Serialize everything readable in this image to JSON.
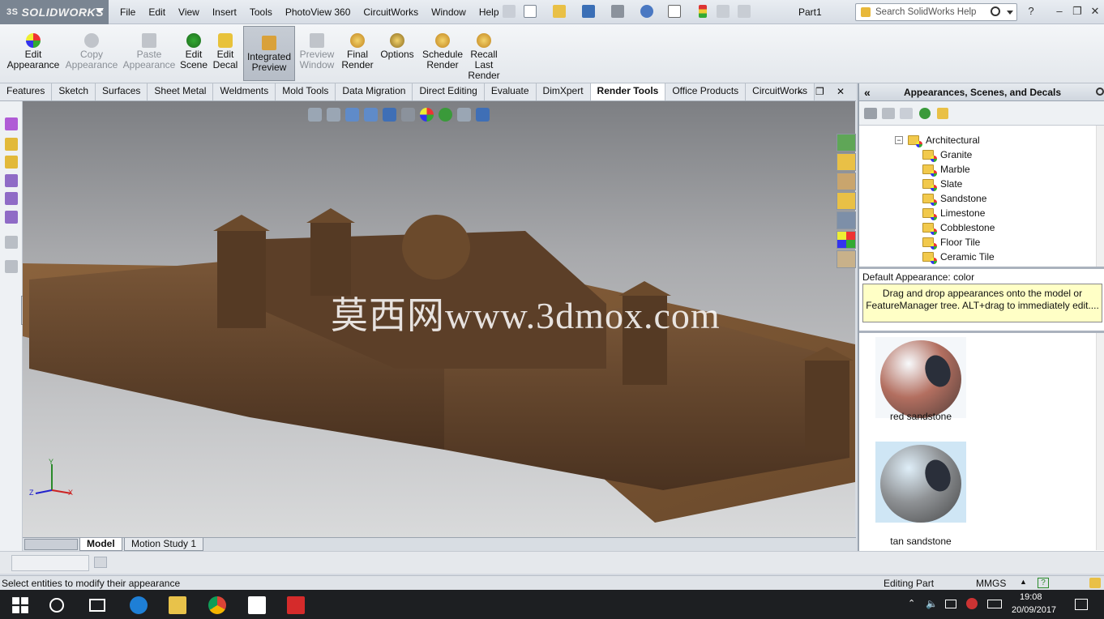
{
  "app": {
    "brand": "SOLIDWORKS",
    "brand_prefix": "3S",
    "document_title": "Part1"
  },
  "menu": [
    "File",
    "Edit",
    "View",
    "Insert",
    "Tools",
    "PhotoView 360",
    "CircuitWorks",
    "Window",
    "Help"
  ],
  "search": {
    "placeholder": "Search SolidWorks Help"
  },
  "ribbon": {
    "buttons": [
      {
        "label": "Edit\nAppearance",
        "enabled": true,
        "active": false,
        "icon": "edit-appearance-icon"
      },
      {
        "label": "Copy\nAppearance",
        "enabled": false,
        "active": false,
        "icon": "copy-appearance-icon"
      },
      {
        "label": "Paste\nAppearance",
        "enabled": false,
        "active": false,
        "icon": "paste-appearance-icon"
      },
      {
        "label": "Edit\nScene",
        "enabled": true,
        "active": false,
        "icon": "edit-scene-icon"
      },
      {
        "label": "Edit\nDecal",
        "enabled": true,
        "active": false,
        "icon": "edit-decal-icon"
      },
      {
        "label": "Integrated\nPreview",
        "enabled": true,
        "active": true,
        "icon": "integrated-preview-icon"
      },
      {
        "label": "Preview\nWindow",
        "enabled": false,
        "active": false,
        "icon": "preview-window-icon"
      },
      {
        "label": "Final\nRender",
        "enabled": true,
        "active": false,
        "icon": "final-render-icon"
      },
      {
        "label": "Options",
        "enabled": true,
        "active": false,
        "icon": "options-icon"
      },
      {
        "label": "Schedule\nRender",
        "enabled": true,
        "active": false,
        "icon": "schedule-render-icon"
      },
      {
        "label": "Recall\nLast\nRender",
        "enabled": true,
        "active": false,
        "icon": "recall-last-render-icon"
      }
    ]
  },
  "tabs": [
    {
      "label": "Features",
      "active": false
    },
    {
      "label": "Sketch",
      "active": false
    },
    {
      "label": "Surfaces",
      "active": false
    },
    {
      "label": "Sheet Metal",
      "active": false
    },
    {
      "label": "Weldments",
      "active": false
    },
    {
      "label": "Mold Tools",
      "active": false
    },
    {
      "label": "Data Migration",
      "active": false
    },
    {
      "label": "Direct Editing",
      "active": false
    },
    {
      "label": "Evaluate",
      "active": false
    },
    {
      "label": "DimXpert",
      "active": false
    },
    {
      "label": "Render Tools",
      "active": true
    },
    {
      "label": "Office Products",
      "active": false
    },
    {
      "label": "CircuitWorks",
      "active": false
    }
  ],
  "viewport": {
    "watermark": "莫西网www.3dmox.com",
    "triad": {
      "x": "X",
      "y": "Y",
      "z": "Z"
    }
  },
  "bottom_tabs": [
    {
      "label": "Model",
      "active": true
    },
    {
      "label": "Motion Study 1",
      "active": false
    }
  ],
  "task_pane": {
    "title": "Appearances, Scenes, and Decals",
    "collapse_glyph": "«",
    "tree": {
      "parent": "Architectural",
      "children": [
        "Granite",
        "Marble",
        "Slate",
        "Sandstone",
        "Limestone",
        "Cobblestone",
        "Floor Tile",
        "Ceramic Tile"
      ]
    },
    "default_appearance": "Default Appearance: color",
    "tip": "Drag and drop appearances onto the model or FeatureManager tree.  ALT+drag to immediately edit....",
    "swatches": [
      {
        "label": "red sandstone",
        "color": "#b36f60"
      },
      {
        "label": "tan sandstone",
        "color": "#8f9295"
      }
    ]
  },
  "status": {
    "message": "Select entities to modify their appearance",
    "mode": "Editing Part",
    "units": "MMGS"
  },
  "taskbar": {
    "time": "19:08",
    "date": "20/09/2017"
  }
}
